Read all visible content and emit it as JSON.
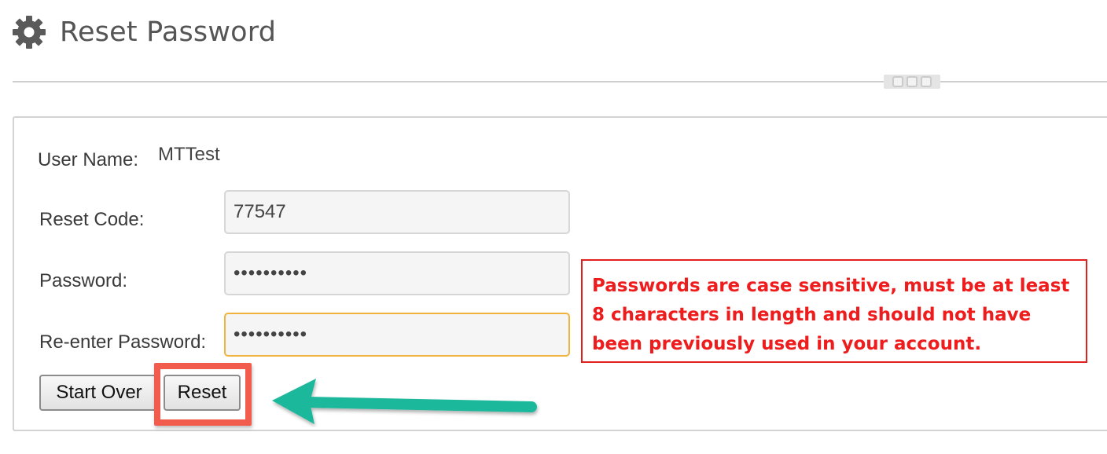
{
  "header": {
    "title": "Reset Password",
    "icon": "gear-icon"
  },
  "form": {
    "user_name_label": "User Name:",
    "user_name_value": "MTTest",
    "reset_code_label": "Reset Code:",
    "reset_code_value": "77547",
    "password_label": "Password:",
    "password_mask": "••••••••••",
    "reenter_label": "Re-enter Password:",
    "reenter_mask": "••••••••••"
  },
  "notice": {
    "text": "Passwords are case sensitive, must be at least 8 characters in length and should not have been previously used in your account."
  },
  "buttons": {
    "start_over": "Start Over",
    "reset": "Reset"
  },
  "colors": {
    "notice_red": "#ee1c1c",
    "highlight": "#f25c4c",
    "arrow_teal": "#1bb89b",
    "focus_border": "#f1b33c"
  }
}
